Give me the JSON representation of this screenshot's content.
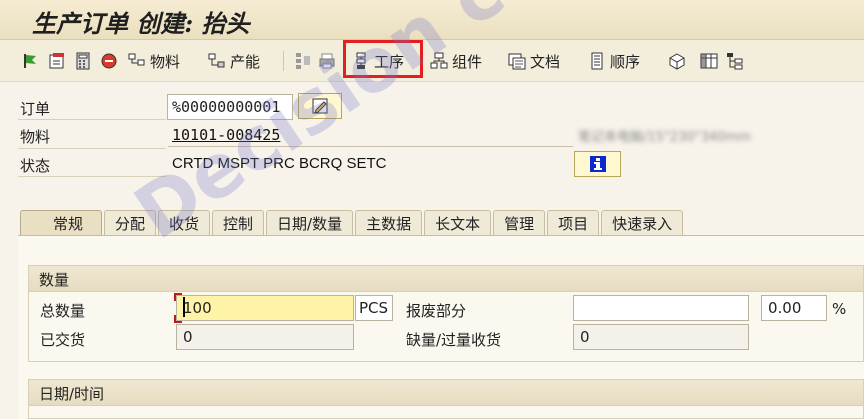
{
  "window": {
    "title": "生产订单 创建: 抬头"
  },
  "toolbar": {
    "material_label": "物料",
    "capacity_label": "产能",
    "operations_label": "工序",
    "components_label": "组件",
    "documents_label": "文档",
    "sequences_label": "顺序"
  },
  "header": {
    "order_label": "订单",
    "order_value": "%00000000001",
    "material_label": "物料",
    "material_value": "10101-008425",
    "material_desc": "笔记本电脑/15\"230\"340mm",
    "status_label": "状态",
    "status_value": "CRTD MSPT PRC  BCRQ SETC"
  },
  "tabs": [
    "常规",
    "分配",
    "收货",
    "控制",
    "日期/数量",
    "主数据",
    "长文本",
    "管理",
    "项目",
    "快速录入"
  ],
  "quantity": {
    "section_title": "数量",
    "total_qty_label": "总数量",
    "total_qty_value": "100",
    "unit": "PCS",
    "scrap_label": "报废部分",
    "scrap_value": "",
    "scrap_pct": "0.00",
    "pct_sign": "%",
    "delivered_label": "已交货",
    "delivered_value": "0",
    "short_over_label": "缺量/过量收货",
    "short_over_value": "0"
  },
  "dates": {
    "section_title": "日期/时间"
  },
  "watermark": "Decision copyright",
  "colors": {
    "highlight": "#e31f1f",
    "input_yellow": "#fff3a8",
    "info_button": "#0a2ad0"
  }
}
